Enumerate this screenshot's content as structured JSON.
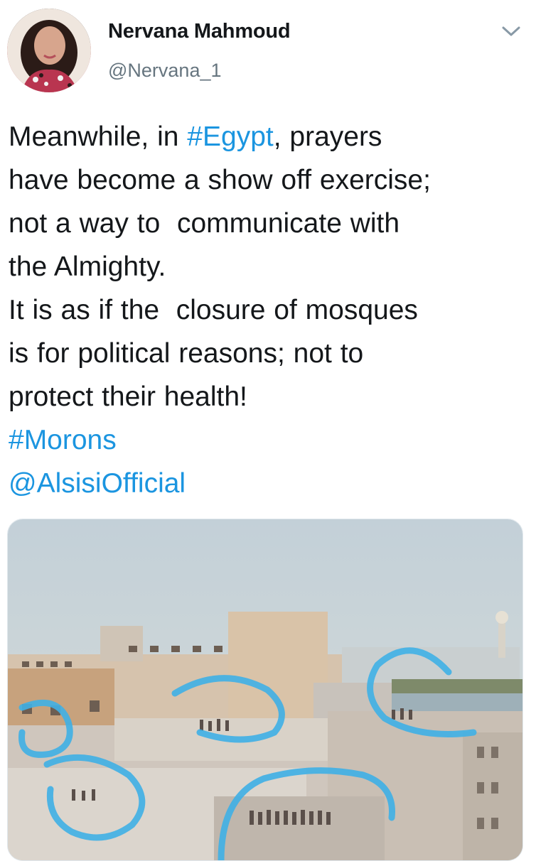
{
  "tweet": {
    "author": {
      "name": "Nervana Mahmoud",
      "handle": "@Nervana_1"
    },
    "text": {
      "line1_a": "Meanwhile, in ",
      "line1_hashtag": "#Egypt",
      "line1_b": ", prayers",
      "line2": "have become a show off exercise;",
      "line3": "not a way to  communicate with",
      "line4": "the Almighty.",
      "line5": "It is as if the  closure of mosques",
      "line6": "is for political reasons; not to",
      "line7": "protect their health!",
      "hashtag": "#Morons",
      "mention": "@AlsisiOfficial"
    },
    "icons": {
      "menu": "chevron-down-icon"
    },
    "colors": {
      "link": "#1b95e0",
      "secondary_text": "#66757f",
      "annotation": "#3fb0e6"
    }
  }
}
